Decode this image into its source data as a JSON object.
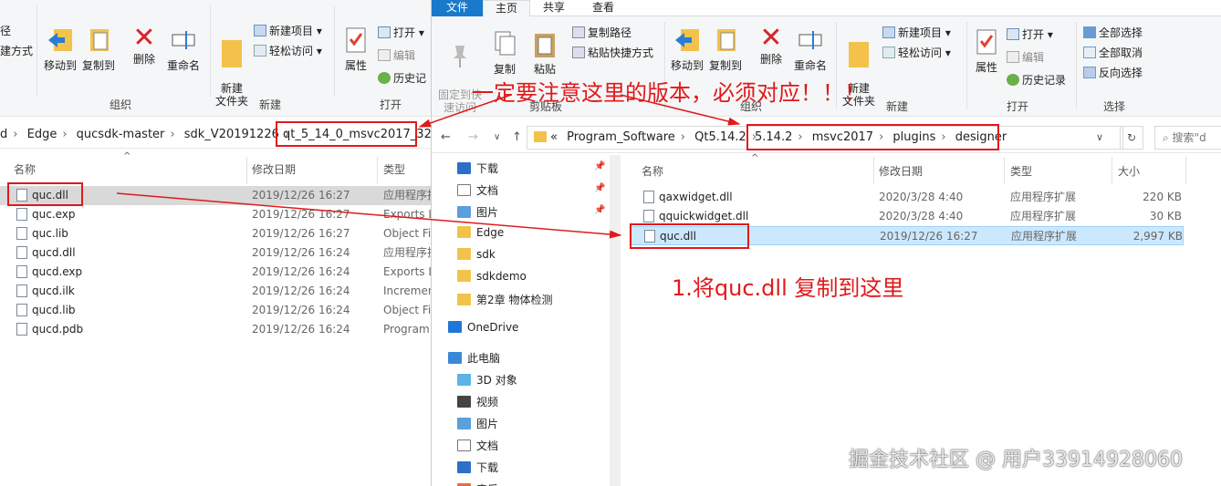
{
  "left": {
    "ribbon": {
      "cut_label": "径",
      "paste_shortcut_label": "建方式",
      "move_to": "移动到",
      "copy_to": "复制到",
      "delete": "删除",
      "rename": "重命名",
      "new_folder": "新建\n文件夹",
      "new_item": "新建项目",
      "easy_access": "轻松访问",
      "properties": "属性",
      "open": "打开",
      "edit": "编辑",
      "history": "历史记",
      "group_organize": "组织",
      "group_new": "新建",
      "group_open": "打开"
    },
    "breadcrumb": [
      "d",
      "Edge",
      "qucsdk-master",
      "sdk_V20191226",
      "qt_5_14_0_msvc2017_32"
    ],
    "columns": {
      "name": "名称",
      "date": "修改日期",
      "type": "类型"
    },
    "files": [
      {
        "name": "quc.dll",
        "date": "2019/12/26 16:27",
        "type": "应用程序扩",
        "icon": "dll-icon"
      },
      {
        "name": "quc.exp",
        "date": "2019/12/26 16:27",
        "type": "Exports L",
        "icon": "exp-icon"
      },
      {
        "name": "quc.lib",
        "date": "2019/12/26 16:27",
        "type": "Object Fi",
        "icon": "lib-icon"
      },
      {
        "name": "qucd.dll",
        "date": "2019/12/26 16:24",
        "type": "应用程序扩",
        "icon": "dll-icon"
      },
      {
        "name": "qucd.exp",
        "date": "2019/12/26 16:24",
        "type": "Exports L",
        "icon": "exp-icon"
      },
      {
        "name": "qucd.ilk",
        "date": "2019/12/26 16:24",
        "type": "Incremen",
        "icon": "ilk-icon"
      },
      {
        "name": "qucd.lib",
        "date": "2019/12/26 16:24",
        "type": "Object Fi",
        "icon": "lib-icon"
      },
      {
        "name": "qucd.pdb",
        "date": "2019/12/26 16:24",
        "type": "Program",
        "icon": "pdb-icon"
      }
    ]
  },
  "right": {
    "tabs": [
      "文件",
      "主页",
      "共享",
      "查看"
    ],
    "ribbon": {
      "pin": "固定到快\n速访问",
      "copy": "复制",
      "paste": "粘贴",
      "copy_path": "复制路径",
      "paste_shortcut": "粘贴快捷方式",
      "group_clipboard": "剪贴板",
      "move_to": "移动到",
      "copy_to": "复制到",
      "delete": "删除",
      "rename": "重命名",
      "group_organize": "组织",
      "new_folder": "新建\n文件夹",
      "new_item": "新建项目",
      "easy_access": "轻松访问",
      "group_new": "新建",
      "properties": "属性",
      "open": "打开",
      "edit": "编辑",
      "history": "历史记录",
      "group_open": "打开",
      "select_all": "全部选择",
      "select_none": "全部取消",
      "invert": "反向选择",
      "group_select": "选择"
    },
    "breadcrumb": [
      "«",
      "Program_Software",
      "Qt5.14.2",
      "5.14.2",
      "msvc2017",
      "plugins",
      "designer"
    ],
    "search_placeholder": "搜索\"d",
    "nav": [
      {
        "label": "下载",
        "icon": "download-icon",
        "pinned": true
      },
      {
        "label": "文档",
        "icon": "document-icon",
        "pinned": true
      },
      {
        "label": "图片",
        "icon": "picture-icon",
        "pinned": true
      },
      {
        "label": "Edge",
        "icon": "folder-icon",
        "pinned": false
      },
      {
        "label": "sdk",
        "icon": "folder-icon",
        "pinned": false
      },
      {
        "label": "sdkdemo",
        "icon": "folder-icon",
        "pinned": false
      },
      {
        "label": "第2章 物体检测",
        "icon": "folder-icon",
        "pinned": false
      },
      {
        "label": "OneDrive",
        "icon": "cloud-icon",
        "pinned": false
      },
      {
        "label": "此电脑",
        "icon": "computer-icon",
        "pinned": false
      },
      {
        "label": "3D 对象",
        "icon": "cube-icon",
        "pinned": false
      },
      {
        "label": "视频",
        "icon": "video-icon",
        "pinned": false
      },
      {
        "label": "图片",
        "icon": "picture-icon",
        "pinned": false
      },
      {
        "label": "文档",
        "icon": "document-icon",
        "pinned": false
      },
      {
        "label": "下载",
        "icon": "download-icon",
        "pinned": false
      },
      {
        "label": "音乐",
        "icon": "music-icon",
        "pinned": false
      }
    ],
    "columns": {
      "name": "名称",
      "date": "修改日期",
      "type": "类型",
      "size": "大小"
    },
    "files": [
      {
        "name": "qaxwidget.dll",
        "date": "2020/3/28 4:40",
        "type": "应用程序扩展",
        "size": "220 KB"
      },
      {
        "name": "qquickwidget.dll",
        "date": "2020/3/28 4:40",
        "type": "应用程序扩展",
        "size": "30 KB"
      },
      {
        "name": "quc.dll",
        "date": "2019/12/26 16:27",
        "type": "应用程序扩展",
        "size": "2,997 KB"
      }
    ]
  },
  "annotations": {
    "version_note": "一定要注意这里的版本，必须对应！！！",
    "copy_note": "1.将quc.dll 复制到这里"
  },
  "watermark": "掘金技术社区 @ 用户33914928060",
  "colors": {
    "annotation_red": "#e0191b",
    "selected_row": "#cce8ff",
    "file_tab": "#1979ca"
  }
}
